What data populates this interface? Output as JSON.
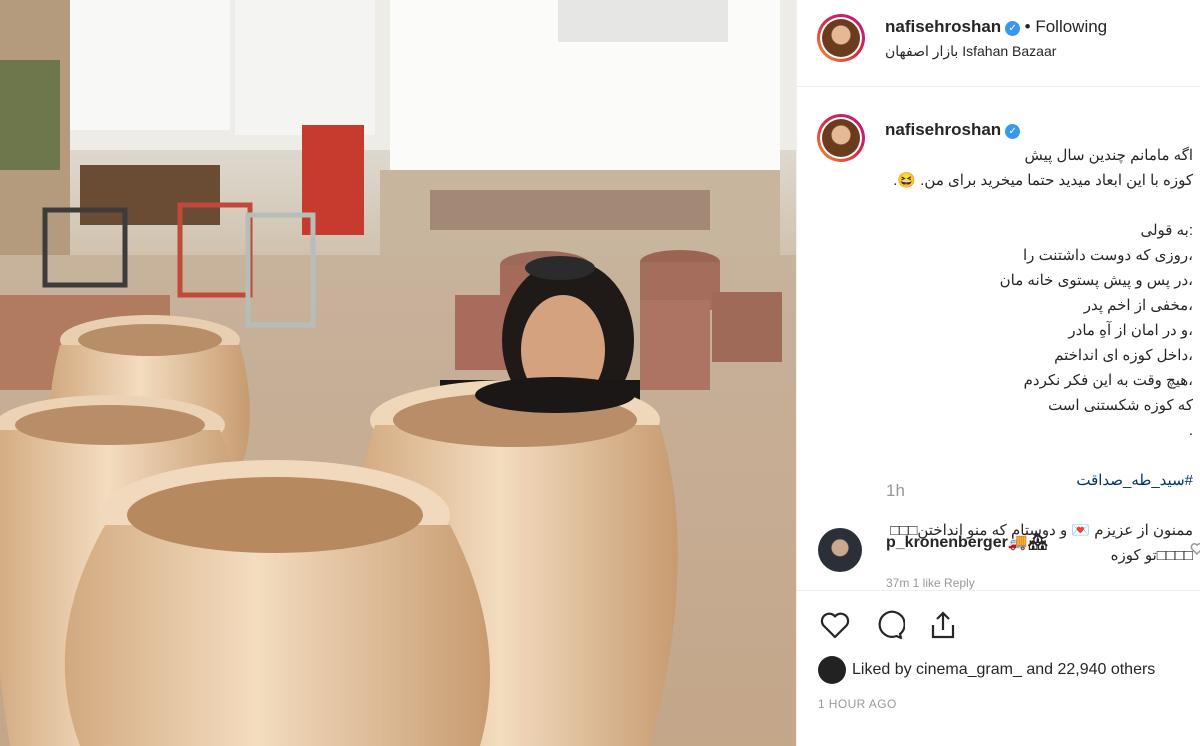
{
  "post": {
    "username": "nafisehroshan",
    "follow_status": "• Following",
    "location": "بازار اصفهان Isfahan Bazaar",
    "caption": "اگه مامانم چندین سال پیش\nکوزه با این ابعاد میدید حتما میخرید برای من. 😆.\n\n:به قولی\n،روزی که دوست داشتنت را\n،در پس و پیش پستوی خانه مان\n،مخفی از اخم پدر\n،و در امان از آهِ مادر\n،داخل کوزه ای انداختم\n،هیچ وقت به این فکر نکردم\nکه کوزه شکستنی است\n.",
    "hashtag": "#سید_طه_صداقت",
    "caption_tail": "ممنون از عزیزم 💌 و دوستام که منو انداختن□□□\n□□□□تو کوزه",
    "time_ago": "1h"
  },
  "comment": {
    "username": "p_kronenberger",
    "emoji": "🚚🏘",
    "meta": "37m   1 like   Reply"
  },
  "engagement": {
    "likes_text": "Liked by cinema_gram_ and 22,940 others",
    "timestamp": "1 HOUR AGO"
  },
  "icons": [
    "verified-badge-icon",
    "heart-icon",
    "comment-icon",
    "share-icon",
    "comment-like-icon"
  ],
  "colors": {
    "verified": "#3897f0",
    "muted": "#999999",
    "link": "#003569"
  }
}
